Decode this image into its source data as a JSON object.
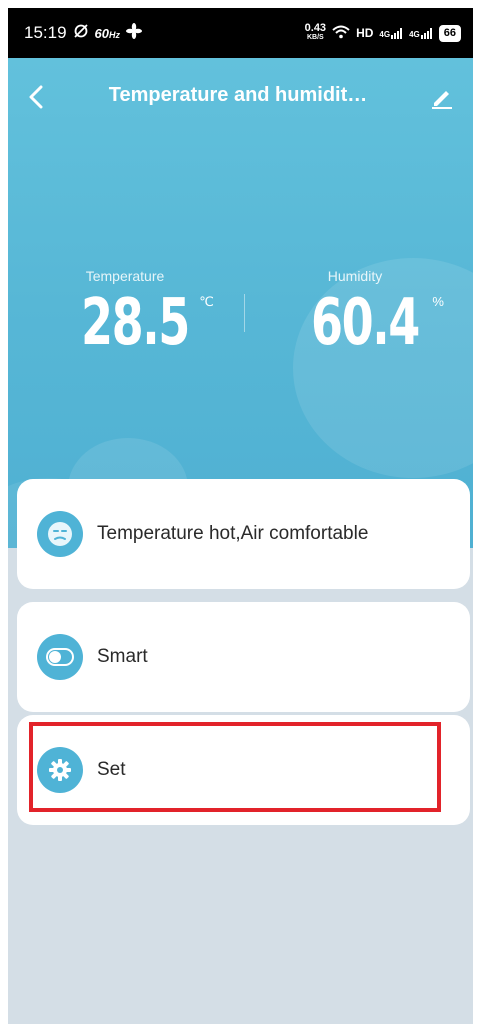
{
  "status_bar": {
    "time": "15:19",
    "refresh": "60",
    "refresh_unit": "Hz",
    "speed": "0.43",
    "speed_unit": "KB/S",
    "hd": "HD",
    "net1": "4G",
    "net2": "4G",
    "battery": "66"
  },
  "header": {
    "title": "Temperature and humidit…"
  },
  "readings": {
    "temperature": {
      "label": "Temperature",
      "value": "28.5",
      "unit": "℃"
    },
    "humidity": {
      "label": "Humidity",
      "value": "60.4",
      "unit": "%"
    }
  },
  "cards": {
    "status": {
      "label": "Temperature hot,Air comfortable",
      "icon": "face-icon"
    },
    "smart": {
      "label": "Smart",
      "icon": "toggle-icon"
    },
    "set": {
      "label": "Set",
      "icon": "gear-icon"
    }
  },
  "colors": {
    "accent": "#4fb3d6",
    "highlight": "#e2232a"
  }
}
